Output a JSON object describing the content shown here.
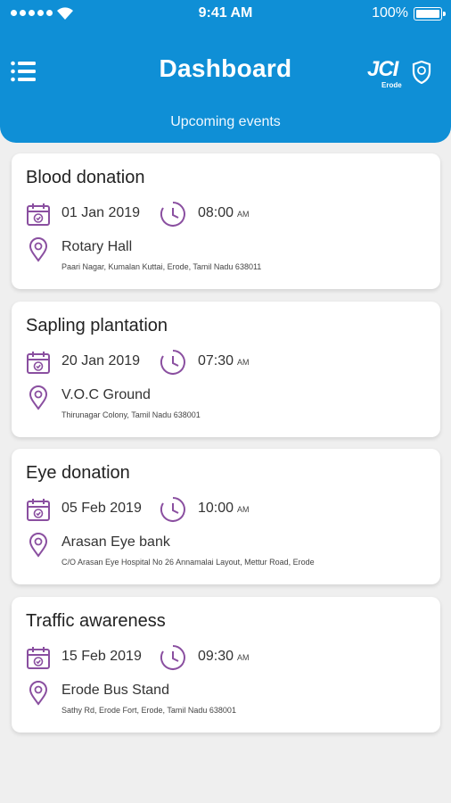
{
  "status_bar": {
    "time": "9:41 AM",
    "battery": "100%"
  },
  "header": {
    "title": "Dashboard",
    "subtitle": "Upcoming events",
    "logo": {
      "text": "JCI",
      "sub": "Erode"
    }
  },
  "icons": {
    "menu": "hamburger-menu-icon",
    "calendar": "calendar-icon",
    "clock": "clock-icon",
    "location": "location-pin-icon"
  },
  "colors": {
    "header_bg": "#0f8fd6",
    "icon_accent": "#8a4fa0",
    "page_bg": "#efefef"
  },
  "events": [
    {
      "title": "Blood donation",
      "date": "01 Jan 2019",
      "time": "08:00",
      "ampm": "AM",
      "place": "Rotary Hall",
      "address": "Paari Nagar, Kumalan Kuttai, Erode, Tamil Nadu 638011"
    },
    {
      "title": "Sapling plantation",
      "date": "20 Jan 2019",
      "time": "07:30",
      "ampm": "AM",
      "place": "V.O.C Ground",
      "address": "Thirunagar Colony, Tamil Nadu 638001"
    },
    {
      "title": "Eye donation",
      "date": "05 Feb 2019",
      "time": "10:00",
      "ampm": "AM",
      "place": "Arasan Eye bank",
      "address": "C/O Arasan Eye Hospital No 26 Annamalai Layout, Mettur Road, Erode"
    },
    {
      "title": "Traffic awareness",
      "date": "15 Feb 2019",
      "time": "09:30",
      "ampm": "AM",
      "place": "Erode Bus Stand",
      "address": "Sathy Rd, Erode Fort, Erode, Tamil Nadu 638001"
    }
  ]
}
